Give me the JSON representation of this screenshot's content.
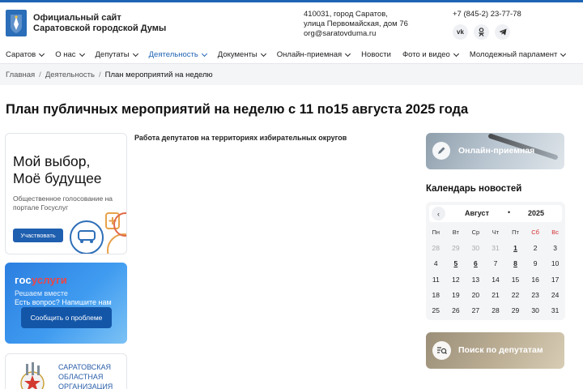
{
  "header": {
    "title_line1": "Официальный сайт",
    "title_line2": "Саратовской городской Думы",
    "address_line1": "410031, город Саратов,",
    "address_line2": "улица Первомайская, дом 76",
    "email": "org@saratovduma.ru",
    "phone": "+7 (845-2) 23-77-78",
    "socials": [
      {
        "icon": "vk-icon",
        "label": "vk"
      },
      {
        "icon": "ok-icon",
        "label": "ok"
      },
      {
        "icon": "telegram-icon",
        "label": "tg"
      }
    ]
  },
  "nav": {
    "items": [
      {
        "label": "Саратов",
        "has_menu": true
      },
      {
        "label": "О нас",
        "has_menu": true
      },
      {
        "label": "Депутаты",
        "has_menu": true
      },
      {
        "label": "Деятельность",
        "has_menu": true,
        "active": true
      },
      {
        "label": "Документы",
        "has_menu": true
      },
      {
        "label": "Онлайн-приемная",
        "has_menu": true
      },
      {
        "label": "Новости",
        "has_menu": false
      },
      {
        "label": "Фото и видео",
        "has_menu": true
      },
      {
        "label": "Молодежный парламент",
        "has_menu": true
      }
    ]
  },
  "breadcrumbs": {
    "home": "Главная",
    "section": "Деятельность",
    "current": "План мероприятий на неделю",
    "separator": "/"
  },
  "page": {
    "title": "План публичных мероприятий на неделю с 11 по15 августа 2025 года",
    "content": "Работа депутатов на территориях избирательных округов"
  },
  "banners": {
    "vote": {
      "title_line1": "Мой выбор,",
      "title_line2": "Моё будущее",
      "subtitle": "Общественное голосование на портале Госуслуг",
      "button": "Участвовать"
    },
    "gosuslugi": {
      "logo_part1": "гос",
      "logo_part2": "услуги",
      "line1": "Решаем вместе",
      "line2": "Есть вопрос? Напишите нам",
      "button": "Сообщить о проблеме"
    },
    "organization": {
      "line1": "САРАТОВСКАЯ",
      "line2": "ОБЛАСТНАЯ",
      "line3": "ОРГАНИЗАЦИЯ"
    }
  },
  "sidebar": {
    "online_reception": "Онлайн-приемная",
    "calendar_title": "Календарь новостей",
    "deputy_search": "Поиск по депутатам"
  },
  "calendar": {
    "prev": "‹",
    "month": "Август",
    "dot": "•",
    "year": "2025",
    "weekdays": [
      "Пн",
      "Вт",
      "Ср",
      "Чт",
      "Пт",
      "Сб",
      "Вс"
    ],
    "weeks": [
      [
        {
          "d": "28",
          "other": true
        },
        {
          "d": "29",
          "other": true
        },
        {
          "d": "30",
          "other": true
        },
        {
          "d": "31",
          "other": true
        },
        {
          "d": "1",
          "event": true
        },
        {
          "d": "2"
        },
        {
          "d": "3"
        }
      ],
      [
        {
          "d": "4"
        },
        {
          "d": "5",
          "event": true
        },
        {
          "d": "6",
          "event": true
        },
        {
          "d": "7"
        },
        {
          "d": "8",
          "event": true
        },
        {
          "d": "9"
        },
        {
          "d": "10"
        }
      ],
      [
        {
          "d": "11"
        },
        {
          "d": "12"
        },
        {
          "d": "13"
        },
        {
          "d": "14"
        },
        {
          "d": "15"
        },
        {
          "d": "16"
        },
        {
          "d": "17"
        }
      ],
      [
        {
          "d": "18"
        },
        {
          "d": "19"
        },
        {
          "d": "20"
        },
        {
          "d": "21"
        },
        {
          "d": "22"
        },
        {
          "d": "23"
        },
        {
          "d": "24"
        }
      ],
      [
        {
          "d": "25"
        },
        {
          "d": "26"
        },
        {
          "d": "27"
        },
        {
          "d": "28"
        },
        {
          "d": "29"
        },
        {
          "d": "30"
        },
        {
          "d": "31"
        }
      ]
    ]
  },
  "colors": {
    "brand_blue": "#1f64b4",
    "weekend_red": "#d32f2f"
  }
}
